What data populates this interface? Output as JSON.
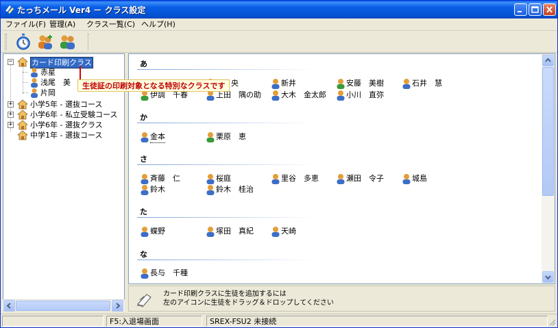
{
  "window": {
    "title": "たっちメール Ver4 － クラス設定"
  },
  "menu": [
    "ファイル(F)",
    "管理(A)",
    "クラス一覧(C)",
    "ヘルプ(H)"
  ],
  "toolbar": {
    "tools": [
      "stopwatch-icon",
      "add-students-icon",
      "students-group-icon"
    ]
  },
  "tree": {
    "root_label": "カード印刷クラス",
    "root_children": [
      "赤星",
      "浅尾　美",
      "片岡"
    ],
    "classes": [
      "小学5年 - 選抜コース",
      "小学6年 - 私立受験コース",
      "小学6年 - 選抜クラス",
      "中学1年 - 選抜コース"
    ]
  },
  "tooltip": "生徒証の印刷対象となる特別なクラスです",
  "sections": [
    {
      "header": "あ",
      "rows": [
        [
          "坂　央",
          "新井",
          "安藤　美樹",
          "石井　慧"
        ],
        [
          "伊調　千春",
          "上田　隅の助",
          "大木　金太郎",
          "小川　直弥"
        ]
      ]
    },
    {
      "header": "か",
      "rows": [
        [
          "金本",
          "栗原　恵"
        ]
      ]
    },
    {
      "header": "さ",
      "rows": [
        [
          "斉藤　仁",
          "桜庭",
          "里谷　多恵",
          "瀬田　令子",
          "城島"
        ],
        [
          "鈴木",
          "鈴木　桂治"
        ]
      ]
    },
    {
      "header": "た",
      "rows": [
        [
          "蝶野",
          "塚田　真紀",
          "天崎"
        ]
      ]
    },
    {
      "header": "な",
      "rows": [
        [
          "長与　千種"
        ]
      ]
    }
  ],
  "hint": {
    "line1": "カード印刷クラスに生徒を追加するには",
    "line2": "左のアイコンに生徒をドラッグ＆ドロップしてください"
  },
  "status": {
    "cell1": "",
    "cell2": "F5:入退場画面",
    "cell3": "SREX-FSU2 未接続"
  },
  "colors": {
    "title_bar": "#0a5fe8",
    "selection": "#316ac5",
    "tooltip_text": "#c00000",
    "tooltip_bg": "#ffffe1"
  }
}
